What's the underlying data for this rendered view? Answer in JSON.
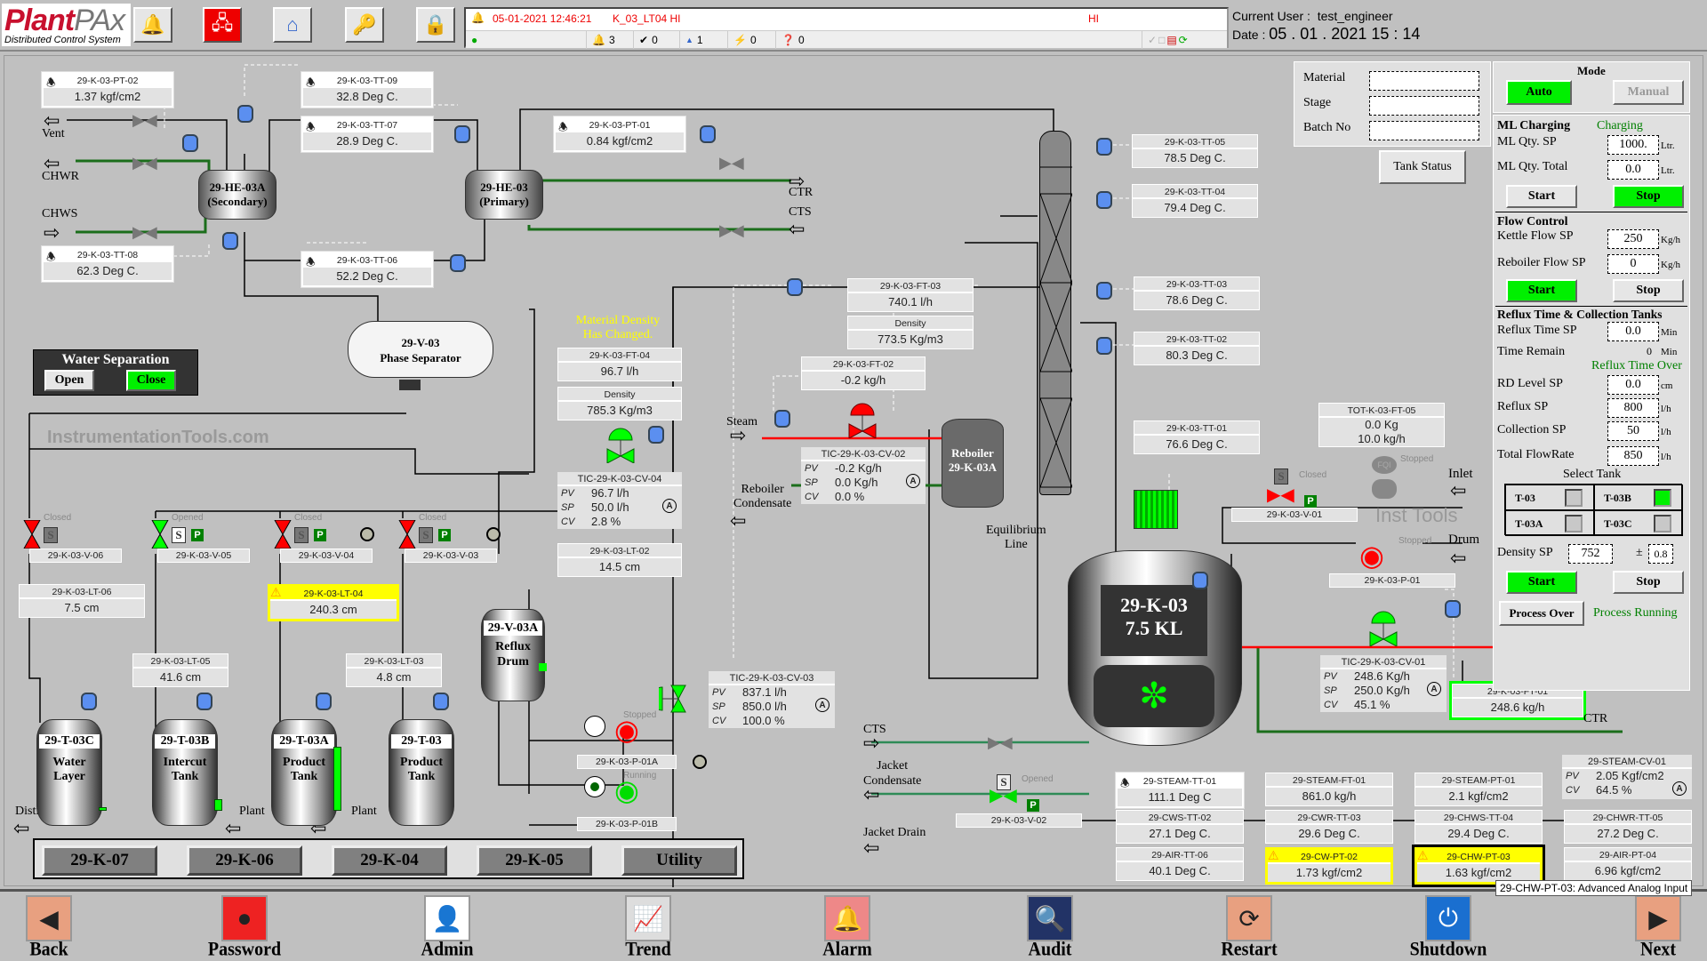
{
  "app": {
    "logo_main": "Plant",
    "logo_accent": "PAx",
    "logo_sub": "Distributed Control System"
  },
  "toolbar": {
    "icons": [
      "alarm-bell-icon",
      "network-icon",
      "home-icon",
      "security-key-icon",
      "lock-icon"
    ]
  },
  "alarm_banner": {
    "timestamp": "05-01-2021 12:46:21",
    "tag": "K_03_LT04 HI",
    "severity": "HI",
    "counts": {
      "active": "3",
      "acknowledged": "0",
      "shelved": "1",
      "suppressed": "0",
      "unknown": "0"
    }
  },
  "user": {
    "user_label": "Current User :",
    "user": "test_engineer",
    "date_label": "Date  :",
    "date": "05 . 01 . 2021 15 : 14"
  },
  "exchangers": {
    "secondary": {
      "line1": "29-HE-03A",
      "line2": "(Secondary)"
    },
    "primary": {
      "line1": "29-HE-03",
      "line2": "(Primary)"
    }
  },
  "streams": {
    "vent": "Vent",
    "chwr": "CHWR",
    "chws": "CHWS",
    "ctr": "CTR",
    "cts": "CTS",
    "steam": "Steam",
    "reboiler_condensate_1": "Reboiler",
    "reboiler_condensate_2": "Condensate",
    "inlet": "Inlet",
    "drum": "Drum",
    "steam2": "Steam",
    "ctr2": "CTR",
    "cts2": "CTS",
    "jacket_cond_1": "Jacket",
    "jacket_cond_2": "Condensate",
    "jacket_drain": "Jacket Drain",
    "distillation": "Distillation",
    "plant1": "Plant",
    "plant2": "Plant",
    "equilibrium_1": "Equilibrium",
    "equilibrium_2": "Line"
  },
  "indicators": {
    "pt02": {
      "tag": "29-K-03-PT-02",
      "value": "1.37 kgf/cm2"
    },
    "tt09": {
      "tag": "29-K-03-TT-09",
      "value": "32.8 Deg C."
    },
    "tt07": {
      "tag": "29-K-03-TT-07",
      "value": "28.9 Deg C."
    },
    "pt01": {
      "tag": "29-K-03-PT-01",
      "value": "0.84 kgf/cm2"
    },
    "tt08": {
      "tag": "29-K-03-TT-08",
      "value": "62.3 Deg C."
    },
    "tt06": {
      "tag": "29-K-03-TT-06",
      "value": "52.2 Deg C."
    },
    "ft03": {
      "tag": "29-K-03-FT-03",
      "value": "740.1 l/h"
    },
    "density1": {
      "tag": "Density",
      "value": "773.5 Kg/m3"
    },
    "ft04": {
      "tag": "29-K-03-FT-04",
      "value": "96.7 l/h"
    },
    "density2": {
      "tag": "Density",
      "value": "785.3 Kg/m3"
    },
    "ft02": {
      "tag": "29-K-03-FT-02",
      "value": "-0.2 kg/h"
    },
    "lt02": {
      "tag": "29-K-03-LT-02",
      "value": "14.5 cm"
    },
    "tt05": {
      "tag": "29-K-03-TT-05",
      "value": "78.5 Deg C."
    },
    "tt04": {
      "tag": "29-K-03-TT-04",
      "value": "79.4 Deg C."
    },
    "tt03": {
      "tag": "29-K-03-TT-03",
      "value": "78.6 Deg C."
    },
    "tt02": {
      "tag": "29-K-03-TT-02",
      "value": "80.3 Deg C."
    },
    "tt01": {
      "tag": "29-K-03-TT-01",
      "value": "76.6 Deg C."
    },
    "lt06": {
      "tag": "29-K-03-LT-06",
      "value": "7.5 cm"
    },
    "lt04": {
      "tag": "29-K-03-LT-04",
      "value": "240.3 cm"
    },
    "lt05": {
      "tag": "29-K-03-LT-05",
      "value": "41.6 cm"
    },
    "lt03": {
      "tag": "29-K-03-LT-03",
      "value": "4.8 cm"
    },
    "ft01": {
      "tag": "29-K-03-FT-01",
      "value": "248.6 kg/h"
    },
    "tot_ft05": {
      "tag": "TOT-K-03-FT-05",
      "value1": "0.0 Kg",
      "value2": "10.0 kg/h"
    }
  },
  "density_alert": {
    "line1": "Material Density",
    "line2": "Has Changed."
  },
  "controllers": {
    "cv04": {
      "tag": "TIC-29-K-03-CV-04",
      "pv": "96.7 l/h",
      "sp": "50.0 l/h",
      "cv": "2.8 %",
      "mode": "A"
    },
    "cv02": {
      "tag": "TIC-29-K-03-CV-02",
      "pv": "-0.2 Kg/h",
      "sp": "0.0 Kg/h",
      "cv": "0.0 %",
      "mode": "A"
    },
    "cv03": {
      "tag": "TIC-29-K-03-CV-03",
      "pv": "837.1 l/h",
      "sp": "850.0 l/h",
      "cv": "100.0 %",
      "mode": "A"
    },
    "cv01": {
      "tag": "TIC-29-K-03-CV-01",
      "pv": "248.6 Kg/h",
      "sp": "250.0 Kg/h",
      "cv": "45.1 %",
      "mode": "A"
    },
    "labels": {
      "pv": "PV",
      "sp": "SP",
      "cv": "CV"
    }
  },
  "vessels": {
    "phase_sep": {
      "line1": "29-V-03",
      "line2": "Phase Separator"
    },
    "reboiler": {
      "line1": "Reboiler",
      "line2": "29-K-03A"
    },
    "reflux_drum": {
      "line1": "29-V-03A",
      "line2": "Reflux",
      "line3": "Drum"
    },
    "reactor": {
      "line1": "29-K-03",
      "line2": "7.5 KL"
    }
  },
  "tanks": [
    {
      "name": "29-T-03C",
      "line1": "Water",
      "line2": "Layer",
      "level_pct": 5
    },
    {
      "name": "29-T-03B",
      "line1": "Intercut",
      "line2": "Tank",
      "level_pct": 15
    },
    {
      "name": "29-T-03A",
      "line1": "Product",
      "line2": "Tank",
      "level_pct": 80
    },
    {
      "name": "29-T-03",
      "line1": "Product",
      "line2": "Tank",
      "level_pct": 0
    }
  ],
  "valves": [
    {
      "tag": "29-K-03-V-06",
      "state": "Closed"
    },
    {
      "tag": "29-K-03-V-05",
      "state": "Opened"
    },
    {
      "tag": "29-K-03-V-04",
      "state": "Closed"
    },
    {
      "tag": "29-K-03-V-03",
      "state": "Closed"
    },
    {
      "tag": "29-K-03-V-01",
      "state": "Closed"
    },
    {
      "tag": "29-K-03-V-02",
      "state": "Opened"
    }
  ],
  "pumps": [
    {
      "tag": "29-K-03-P-01A",
      "state": "Stopped"
    },
    {
      "tag": "29-K-03-P-01B",
      "state": "Running"
    },
    {
      "tag": "29-K-03-P-01",
      "state": "Stopped"
    }
  ],
  "fqi": {
    "label": "FQI",
    "state": "Stopped"
  },
  "watermark": {
    "site": "InstrumentationTools.com",
    "inst": "Inst Tools"
  },
  "water_sep": {
    "title": "Water Separation",
    "open": "Open",
    "close": "Close"
  },
  "batch": {
    "material_label": "Material",
    "stage_label": "Stage",
    "batch_label": "Batch No",
    "material": "",
    "stage": "",
    "batch": "",
    "tank_status": "Tank Status"
  },
  "mode": {
    "title": "Mode",
    "auto": "Auto",
    "manual": "Manual"
  },
  "ml_charging": {
    "title": "ML Charging",
    "status": "Charging",
    "qty_sp_label": "ML  Qty. SP",
    "qty_sp": "1000.",
    "qty_total_label": "ML  Qty. Total",
    "qty_total": "0.0",
    "unit": "Ltr.",
    "start": "Start",
    "stop": "Stop"
  },
  "flow_control": {
    "title": "Flow Control",
    "kettle_label": "Kettle Flow SP",
    "kettle": "250",
    "reboiler_label": "Reboiler Flow SP",
    "reboiler": "0",
    "unit": "Kg/h",
    "start": "Start",
    "stop": "Stop"
  },
  "reflux": {
    "title": "Reflux Time & Collection Tanks",
    "time_sp_label": "Reflux Time SP",
    "time_sp": "0.0",
    "time_unit": "Min",
    "remain_label": "Time Remain",
    "remain": "0",
    "status": "Reflux Time Over",
    "rd_label": "RD Level SP",
    "rd": "0.0",
    "rd_unit": "cm",
    "reflux_sp_label": "Reflux SP",
    "reflux_sp": "800",
    "coll_label": "Collection SP",
    "coll": "50",
    "total_label": "Total FlowRate",
    "total": "850",
    "flow_unit": "l/h",
    "select_title": "Select Tank",
    "select": [
      {
        "label": "T-03",
        "on": false
      },
      {
        "label": "T-03B",
        "on": true
      },
      {
        "label": "T-03A",
        "on": false
      },
      {
        "label": "T-03C",
        "on": false
      }
    ],
    "density_label": "Density SP",
    "density": "752",
    "pm": "±",
    "tol": "0.8",
    "start": "Start",
    "stop": "Stop",
    "process_over": "Process Over",
    "process_status": "Process Running"
  },
  "utilities": [
    {
      "tag": "29-STEAM-TT-01",
      "value": "111.1 Deg C",
      "style": "bell"
    },
    {
      "tag": "29-STEAM-FT-01",
      "value": "861.0 kg/h"
    },
    {
      "tag": "29-STEAM-PT-01",
      "value": "2.1 kgf/cm2"
    },
    {
      "tag": "29-CWS-TT-02",
      "value": "27.1 Deg C."
    },
    {
      "tag": "29-CWR-TT-03",
      "value": "29.6 Deg C."
    },
    {
      "tag": "29-CHWS-TT-04",
      "value": "29.4 Deg C."
    },
    {
      "tag": "29-CHWR-TT-05",
      "value": "27.2 Deg C."
    },
    {
      "tag": "29-AIR-TT-06",
      "value": "40.1 Deg C."
    },
    {
      "tag": "29-CW-PT-02",
      "value": "1.73 kgf/cm2",
      "style": "warn"
    },
    {
      "tag": "29-CHW-PT-03",
      "value": "1.63 kgf/cm2",
      "style": "warn-selected"
    },
    {
      "tag": "29-AIR-PT-04",
      "value": "6.96 kgf/cm2"
    }
  ],
  "steam_cv": {
    "tag": "29-STEAM-CV-01",
    "pv": "2.05 Kgf/cm2",
    "cv": "64.5 %",
    "mode": "A"
  },
  "tooltip": "29-CHW-PT-03: Advanced Analog Input",
  "area_tabs": [
    "29-K-07",
    "29-K-06",
    "29-K-04",
    "29-K-05",
    "Utility"
  ],
  "nav": [
    {
      "label": "Back",
      "icon": "back-arrow-icon"
    },
    {
      "label": "Password",
      "icon": "change-password-icon"
    },
    {
      "label": "Admin",
      "icon": "admin-user-icon"
    },
    {
      "label": "Trend",
      "icon": "trend-chart-icon"
    },
    {
      "label": "Alarm",
      "icon": "alarm-bell-icon"
    },
    {
      "label": "Audit",
      "icon": "audit-icon"
    },
    {
      "label": "Restart",
      "icon": "restart-icon"
    },
    {
      "label": "Shutdown",
      "icon": "power-icon"
    },
    {
      "label": "Next",
      "icon": "next-arrow-icon"
    }
  ],
  "colors": {
    "running": "#00f000",
    "stopped": "#ff0000",
    "alarm": "#ffff00",
    "pipe_green": "#2e8b57",
    "steam_red": "#ff0000"
  }
}
